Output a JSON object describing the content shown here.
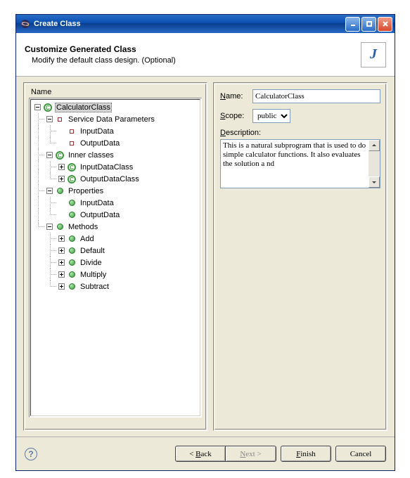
{
  "titlebar": {
    "title": "Create Class"
  },
  "header": {
    "heading": "Customize Generated Class",
    "subheading": "Modify the default class design. (Optional)"
  },
  "tree": {
    "header": "Name",
    "root": {
      "label": "CalculatorClass",
      "icon": "class"
    },
    "groups": [
      {
        "label": "Service Data Parameters",
        "icon": "square-red",
        "expanded": true,
        "children": [
          {
            "label": "InputData",
            "icon": "square-red"
          },
          {
            "label": "OutputData",
            "icon": "square-red"
          }
        ]
      },
      {
        "label": "Inner classes",
        "icon": "class",
        "expanded": true,
        "children": [
          {
            "label": "InputDataClass",
            "icon": "class",
            "expandable": true
          },
          {
            "label": "OutputDataClass",
            "icon": "class",
            "expandable": true
          }
        ]
      },
      {
        "label": "Properties",
        "icon": "method",
        "expanded": true,
        "children": [
          {
            "label": "InputData",
            "icon": "method"
          },
          {
            "label": "OutputData",
            "icon": "method"
          }
        ]
      },
      {
        "label": "Methods",
        "icon": "method",
        "expanded": true,
        "children": [
          {
            "label": "Add",
            "icon": "method",
            "expandable": true
          },
          {
            "label": "Default",
            "icon": "method",
            "expandable": true
          },
          {
            "label": "Divide",
            "icon": "method",
            "expandable": true
          },
          {
            "label": "Multiply",
            "icon": "method",
            "expandable": true
          },
          {
            "label": "Subtract",
            "icon": "method",
            "expandable": true
          }
        ]
      }
    ]
  },
  "form": {
    "name_label": "Name:",
    "name_value": "CalculatorClass",
    "scope_label": "Scope:",
    "scope_value": "public",
    "description_label": "Description:",
    "description_text": "This is a natural subprogram that is used to do simple calculator functions. It also evaluates the solution a nd"
  },
  "buttons": {
    "back": "< Back",
    "next": "Next >",
    "finish": "Finish",
    "cancel": "Cancel"
  }
}
